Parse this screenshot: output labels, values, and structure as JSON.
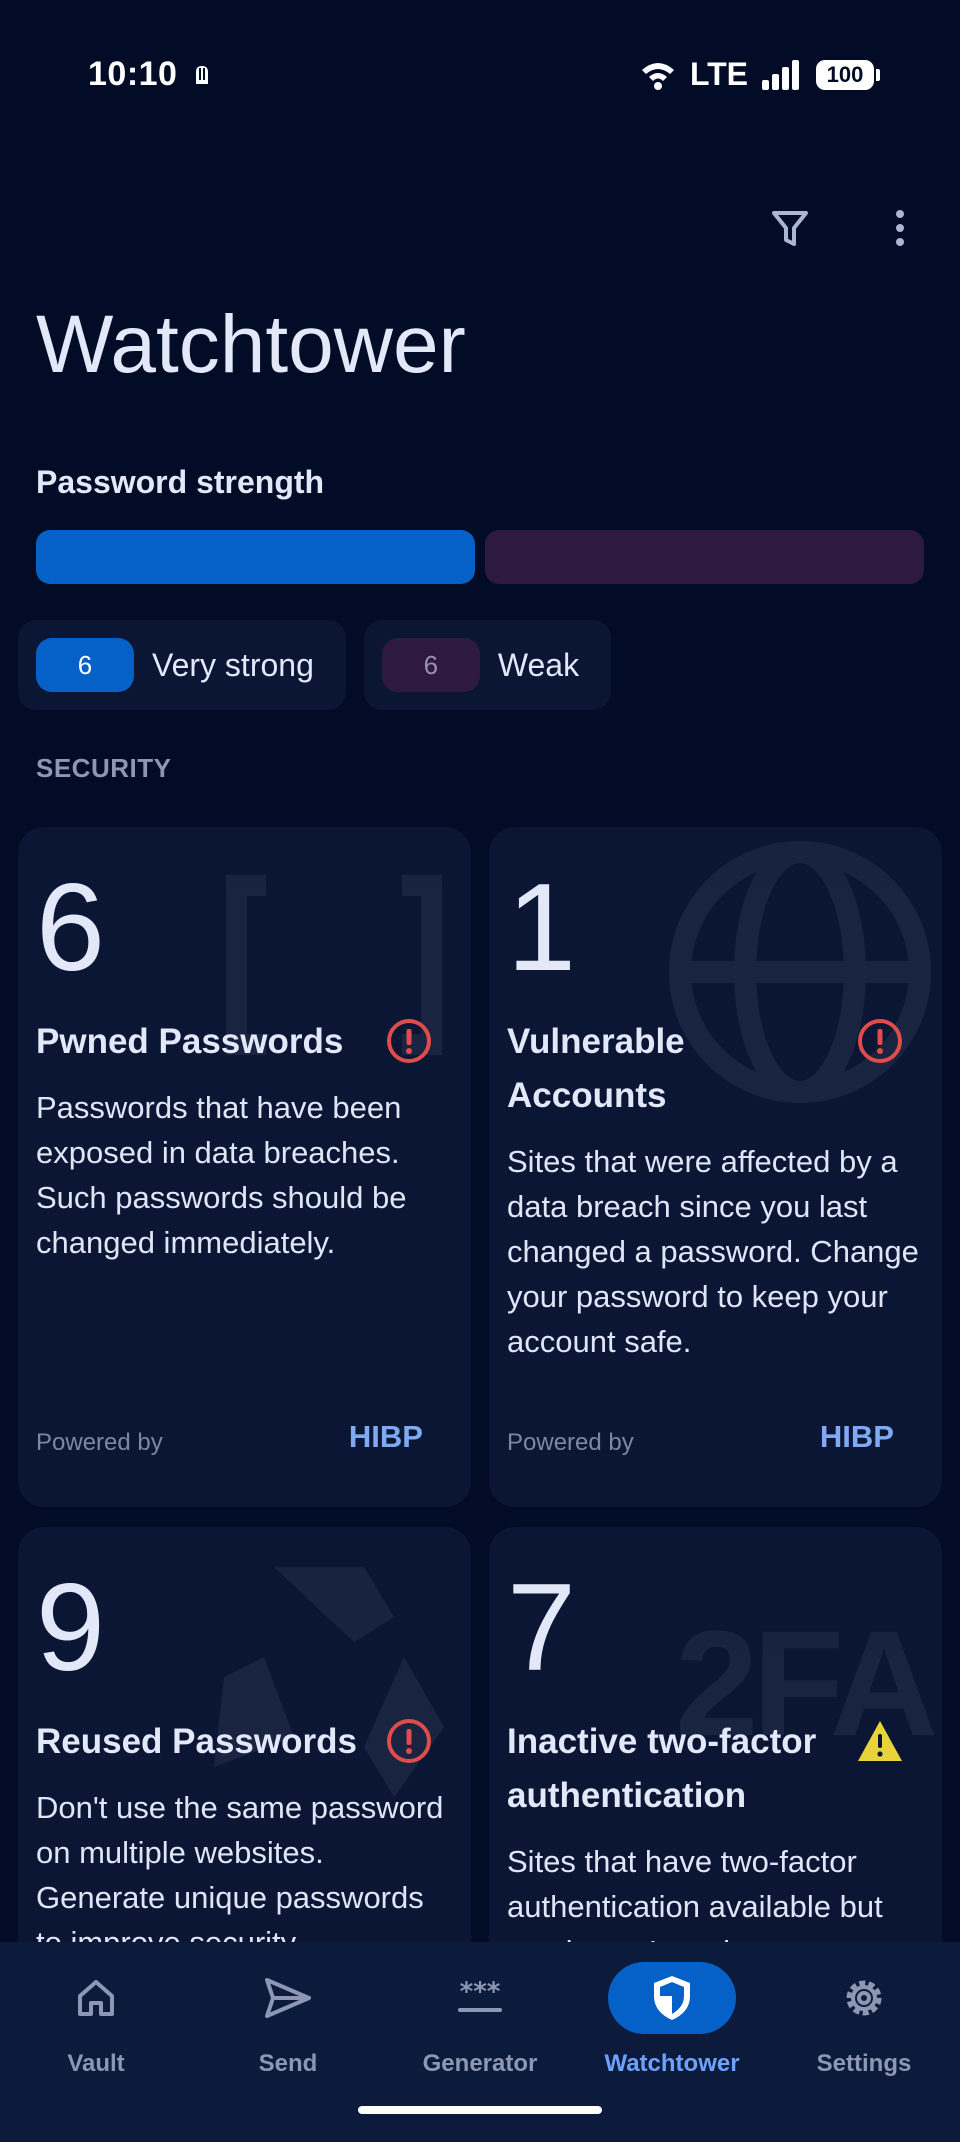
{
  "status_bar": {
    "time": "10:10",
    "network": "LTE",
    "battery": "100",
    "icons": [
      "notification-icon",
      "wifi-icon",
      "signal-icon",
      "battery-icon"
    ]
  },
  "header": {
    "title": "Watchtower",
    "actions": [
      "filter-icon",
      "more-vert-icon"
    ]
  },
  "password_strength": {
    "label": "Password strength",
    "strong_ratio": 0.5,
    "chips": [
      {
        "count": "6",
        "label": "Very strong"
      },
      {
        "count": "6",
        "label": "Weak"
      }
    ]
  },
  "security": {
    "label": "SECURITY",
    "cards": [
      {
        "count": "6",
        "title": "Pwned Passwords",
        "description": "Passwords that have been exposed in data breaches. Such passwords should be changed immediately.",
        "powered_by": "Powered by",
        "source": "HIBP",
        "severity": "error"
      },
      {
        "count": "1",
        "title": "Vulnerable Accounts",
        "description": "Sites that were affected by a data breach since you last changed a password. Change your password to keep your account safe.",
        "powered_by": "Powered by",
        "source": "HIBP",
        "severity": "error"
      },
      {
        "count": "9",
        "title": "Reused Passwords",
        "description": "Don't use the same password on multiple websites. Generate unique passwords to improve security.",
        "severity": "error"
      },
      {
        "count": "7",
        "title": "Inactive two-factor authentication",
        "description": "Sites that have two-factor authentication available but you haven't set it up yet.",
        "severity": "warning"
      }
    ]
  },
  "bottom_nav": {
    "items": [
      {
        "label": "Vault",
        "icon": "home-icon"
      },
      {
        "label": "Send",
        "icon": "send-icon"
      },
      {
        "label": "Generator",
        "icon": "generator-icon"
      },
      {
        "label": "Watchtower",
        "icon": "shield-icon",
        "active": true
      },
      {
        "label": "Settings",
        "icon": "gear-icon"
      }
    ]
  },
  "colors": {
    "background": "#020c26",
    "card": "#0a1634",
    "accent": "#0560c7",
    "weak": "#2e1a40",
    "error": "#e04b4b",
    "warning": "#e8d43a",
    "link": "#7fa9f2"
  }
}
